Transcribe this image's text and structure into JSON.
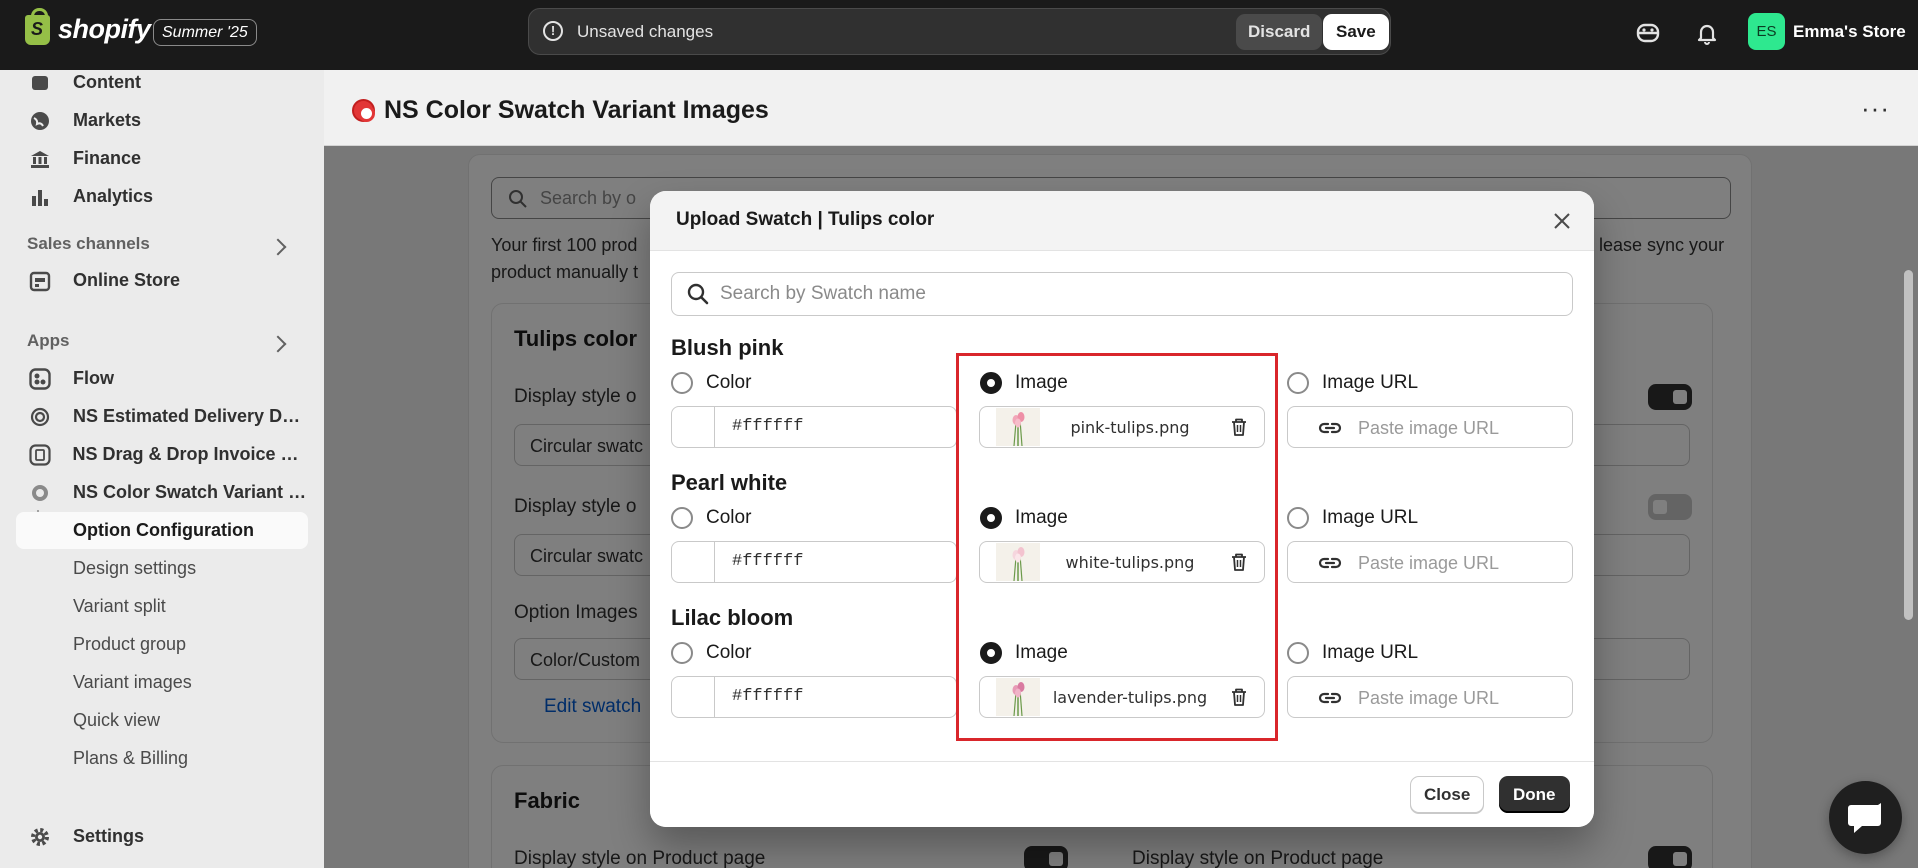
{
  "topbar": {
    "logo_text": "shopify",
    "edition": "Summer '25",
    "unsaved_message": "Unsaved changes",
    "discard_label": "Discard",
    "save_label": "Save",
    "store_initials": "ES",
    "store_name": "Emma's Store",
    "avatar_color": "#2ee88f"
  },
  "sidebar": {
    "items": [
      {
        "label": "Content",
        "icon": "content-icon"
      },
      {
        "label": "Markets",
        "icon": "globe-icon"
      },
      {
        "label": "Finance",
        "icon": "bank-icon"
      },
      {
        "label": "Analytics",
        "icon": "bar-chart-icon"
      }
    ],
    "sales_channels_title": "Sales channels",
    "online_store": "Online Store",
    "apps_title": "Apps",
    "apps": [
      {
        "label": "Flow",
        "icon": "flow-icon"
      },
      {
        "label": "NS Estimated Delivery Date",
        "icon": "app-icon"
      },
      {
        "label": "NS Drag & Drop Invoice Pr...",
        "icon": "invoice-icon"
      },
      {
        "label": "NS Color Swatch Variant I...",
        "icon": "swatch-app-icon"
      }
    ],
    "subitems": [
      "Option Configuration",
      "Design settings",
      "Variant split",
      "Product group",
      "Variant images",
      "Quick view",
      "Plans & Billing"
    ],
    "settings": "Settings"
  },
  "header": {
    "title": "NS Color Swatch Variant Images",
    "more": "···"
  },
  "background": {
    "search_placeholder": "Search by o",
    "notice_line1": "Your first 100 prod",
    "notice_line1_end": "lease sync your",
    "notice_line2": "product manually t",
    "card1_title": "Tulips color",
    "display_style_1": "Display style o",
    "select_1": "Circular swatc",
    "display_style_2": "Display style o",
    "select_2": "Circular swatc",
    "option_images": "Option Images",
    "select_3": "Color/Custom",
    "edit_link": "Edit swatch",
    "card2_title": "Fabric",
    "fabric_display_left": "Display style on Product page",
    "fabric_display_right": "Display style on Product page"
  },
  "modal": {
    "title": "Upload Swatch | Tulips color",
    "search_placeholder": "Search by Swatch name",
    "color_label": "Color",
    "image_label": "Image",
    "image_url_label": "Image URL",
    "url_placeholder": "Paste image URL",
    "swatches": [
      {
        "name": "Blush pink",
        "hex": "#ffffff",
        "file": "pink-tulips.png",
        "selected": "image"
      },
      {
        "name": "Pearl white",
        "hex": "#ffffff",
        "file": "white-tulips.png",
        "selected": "image"
      },
      {
        "name": "Lilac bloom",
        "hex": "#ffffff",
        "file": "lavender-tulips.png",
        "selected": "image"
      }
    ],
    "close_label": "Close",
    "done_label": "Done",
    "highlight_color": "#d9262b"
  }
}
